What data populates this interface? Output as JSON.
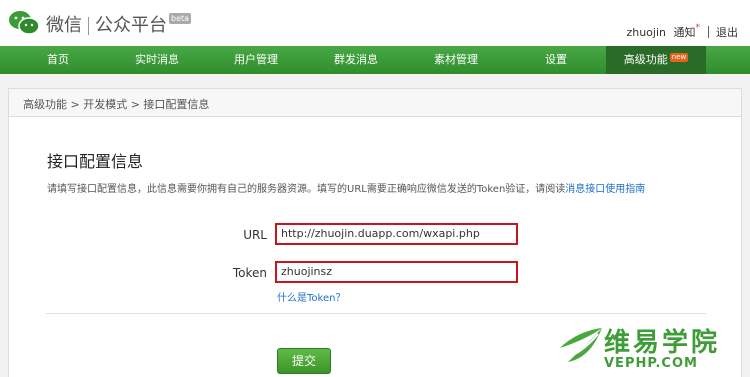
{
  "header": {
    "brand_name": "微信",
    "product_name": "公众平台",
    "beta_badge": "beta",
    "username": "zhuojin",
    "notice_label": "通知",
    "notice_dot": "*",
    "logout_label": "退出"
  },
  "nav": {
    "items": [
      {
        "label": "首页"
      },
      {
        "label": "实时消息"
      },
      {
        "label": "用户管理"
      },
      {
        "label": "群发消息"
      },
      {
        "label": "素材管理"
      },
      {
        "label": "设置"
      },
      {
        "label": "高级功能",
        "badge": "new"
      }
    ],
    "active_index": 6
  },
  "breadcrumb": "高级功能 > 开发模式 > 接口配置信息",
  "main": {
    "title": "接口配置信息",
    "description": "请填写接口配置信息，此信息需要你拥有自己的服务器资源。填写的URL需要正确响应微信发送的Token验证，请阅读",
    "description_link": "消息接口使用指南",
    "url_label": "URL",
    "url_value": "http://zhuojin.duapp.com/wxapi.php",
    "token_label": "Token",
    "token_value": "zhuojinsz",
    "token_help": "什么是Token？",
    "submit_label": "提交"
  },
  "watermark": {
    "text": "维易学院",
    "url": "VEPHP.COM"
  },
  "colors": {
    "nav_green": "#3a9b37",
    "nav_active": "#2b6b28",
    "highlight_red": "#c8141e",
    "link_blue": "#1f6ec7"
  }
}
